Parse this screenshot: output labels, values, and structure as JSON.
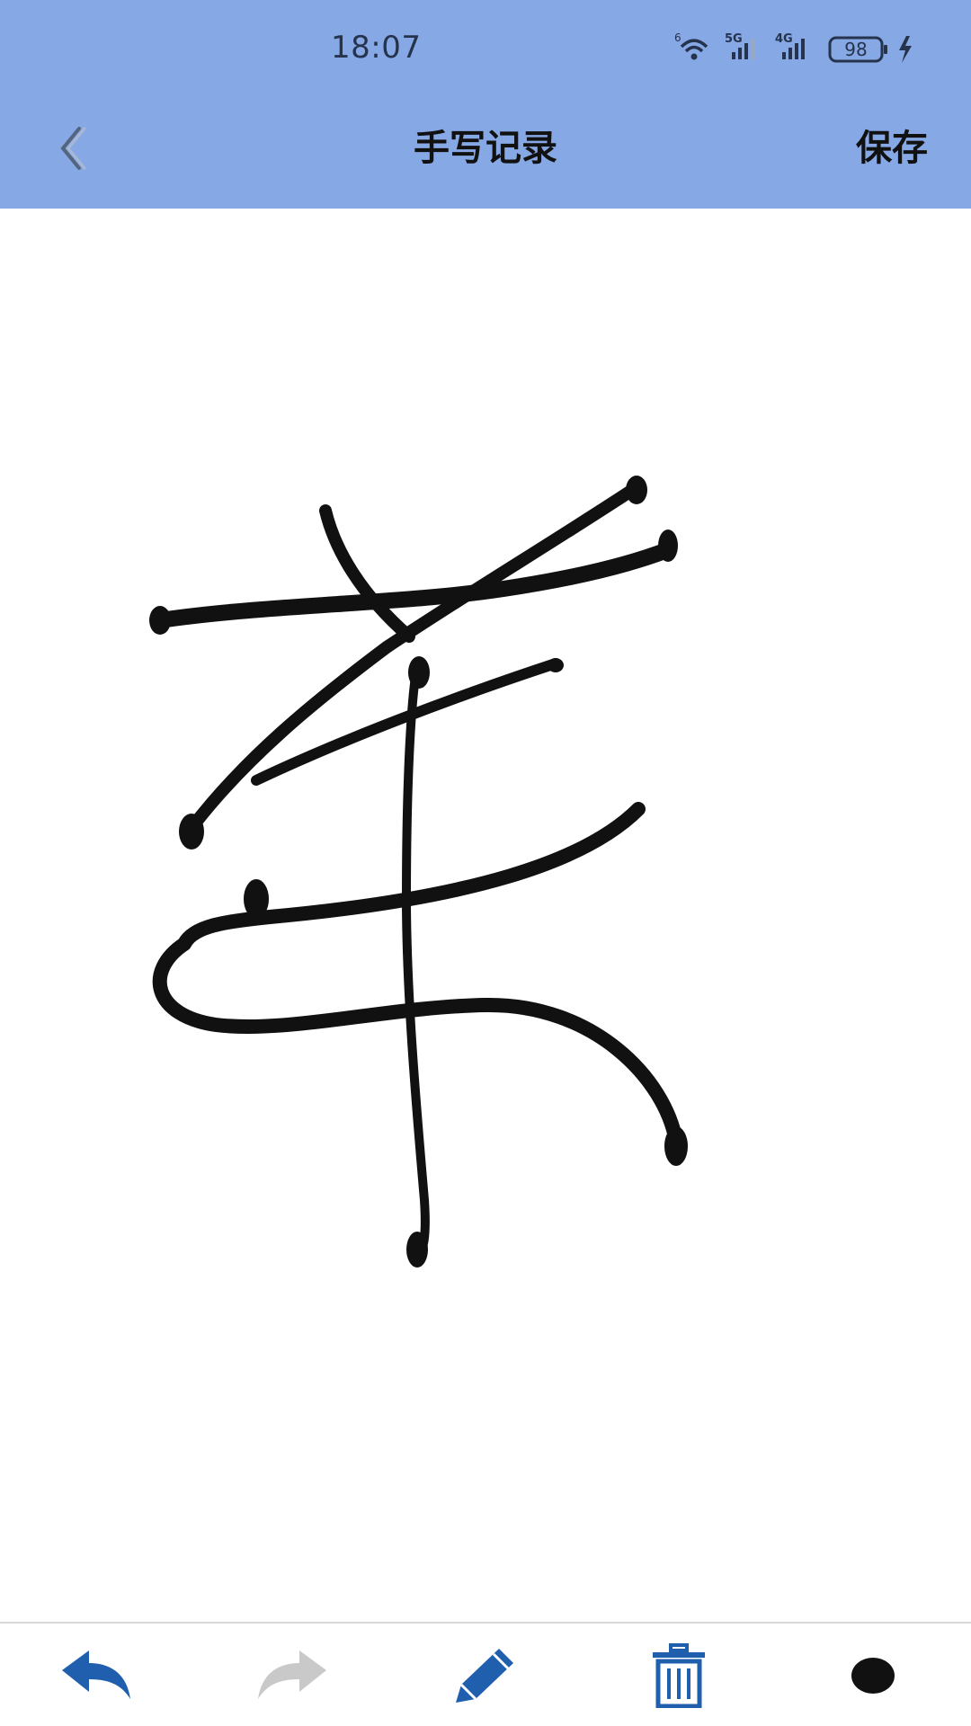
{
  "status_bar": {
    "time": "18:07",
    "wifi_badge": "6",
    "signal_1_badge": "5G",
    "signal_2_badge": "4G",
    "battery_level": "98",
    "icons": [
      "wifi-icon",
      "signal-5g-icon",
      "signal-4g-icon",
      "battery-icon",
      "charging-icon"
    ]
  },
  "header": {
    "back_icon": "chevron-left-icon",
    "title": "手写记录",
    "save_label": "保存"
  },
  "canvas": {
    "stroke_color": "#111111"
  },
  "toolbar": {
    "items": [
      {
        "icon": "undo-icon",
        "color": "#1f5fae"
      },
      {
        "icon": "redo-icon",
        "color": "#c9c9c9"
      },
      {
        "icon": "pen-icon",
        "color": "#1f5fae"
      },
      {
        "icon": "trash-icon",
        "color": "#1f5fae"
      },
      {
        "icon": "brush-size-dot-icon",
        "color": "#111111"
      }
    ]
  },
  "colors": {
    "header_bg": "#86a8e5",
    "accent": "#1f5fae"
  }
}
